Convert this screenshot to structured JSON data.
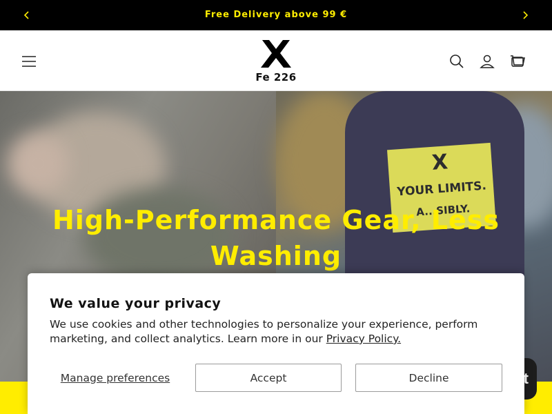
{
  "announcement": {
    "text": "Free Delivery above 99 €",
    "prev_icon": "chevron-left-icon",
    "next_icon": "chevron-right-icon"
  },
  "header": {
    "menu_icon": "hamburger-menu-icon",
    "logo_text": "Fe 226",
    "logo_icon": "x-mark-logo",
    "search_icon": "search-icon",
    "account_icon": "user-icon",
    "cart_icon": "cart-icon"
  },
  "hero": {
    "title_line1": "High-Performance Gear, Less",
    "title_line2": "Washing",
    "patch_line1": "X",
    "patch_line2": "YOUR LIMITS.",
    "patch_line3": "A...SIBLY."
  },
  "cookie_banner": {
    "title": "We value your privacy",
    "description": "We use cookies and other technologies to personalize your experience, perform marketing, and collect analytics. Learn more in our",
    "policy_link": "Privacy Policy.",
    "manage_label": "Manage preferences",
    "accept_label": "Accept",
    "decline_label": "Decline"
  },
  "chat": {
    "label": "t"
  },
  "colors": {
    "accent": "#ffed00",
    "announcement_bg": "#000000",
    "text": "#121212"
  }
}
